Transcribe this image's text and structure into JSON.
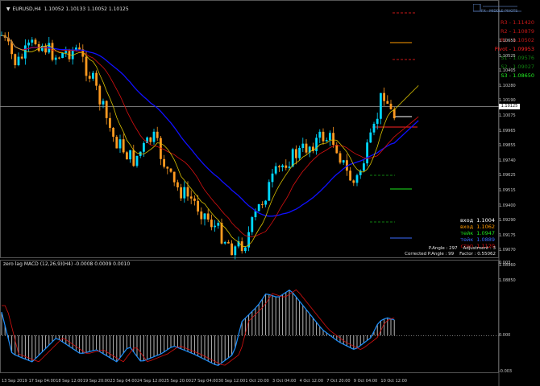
{
  "window": {
    "title": "EURUSD,H4",
    "ohlc": "1.10052 1.10133 1.10052 1.10125"
  },
  "logo": {
    "text": "FX - MIDDLE PIVOTS"
  },
  "pivots": [
    {
      "label": "R3 - 1.11420",
      "color": "#c81818"
    },
    {
      "label": "R2 - 1.10879",
      "color": "#c81818"
    },
    {
      "label": "R1 - 1.10502",
      "color": "#c81818"
    },
    {
      "label": "Pivot - 1.09953",
      "color": "#ff2222"
    },
    {
      "label": "S1 - 1.09576",
      "color": "#108010"
    },
    {
      "label": "S2 - 1.09027",
      "color": "#108010"
    },
    {
      "label": "S3 - 1.08650",
      "color": "#22ee22"
    }
  ],
  "price_axis": [
    "1.10650",
    "1.10525",
    "1.10405",
    "1.10280",
    "1.10190",
    "1.10075",
    "1.09965",
    "1.09855",
    "1.09740",
    "1.09625",
    "1.09515",
    "1.09400",
    "1.09290",
    "1.09175",
    "1.09070",
    "1.08960",
    "1.08850"
  ],
  "current_price": "1.10125",
  "trade_info": [
    {
      "label": "вход  1.1004",
      "color": "#ffffff"
    },
    {
      "label": "вход  1.1062",
      "color": "#ff9a00"
    },
    {
      "label": "тейк  1.0947",
      "color": "#1ee81e"
    },
    {
      "label": "тейк  1.0889",
      "color": "#3a6bff"
    },
    {
      "label": "стоп  1.1120",
      "color": "#e01010"
    }
  ],
  "angle": {
    "line1": "P.Angle : 297    Adjustment : 3",
    "line2": "Corrected P.Angle : 99    Factor : 0.55062"
  },
  "macd": {
    "title": "zero lag MACD (12,26,9)(H4) -0.0008 0.0009 0.0010",
    "axis": [
      "0.003",
      "0.000",
      "-0.003"
    ]
  },
  "time_axis": [
    "13 Sep 2019",
    "17 Sep 04:00",
    "18 Sep 12:00",
    "19 Sep 20:00",
    "23 Sep 04:00",
    "24 Sep 12:00",
    "25 Sep 20:00",
    "27 Sep 04:00",
    "30 Sep 12:00",
    "1 Oct 20:00",
    "3 Oct 04:00",
    "4 Oct 12:00",
    "7 Oct 20:00",
    "9 Oct 04:00",
    "10 Oct 12:00"
  ],
  "colors": {
    "bull": "#00d7ff",
    "bear": "#ff9a20",
    "ma_blue": "#1010ff",
    "ma_red": "#d81010",
    "ma_yellow": "#d8c000",
    "macd_line": "#1e90ff",
    "signal_line": "#d81010"
  }
}
